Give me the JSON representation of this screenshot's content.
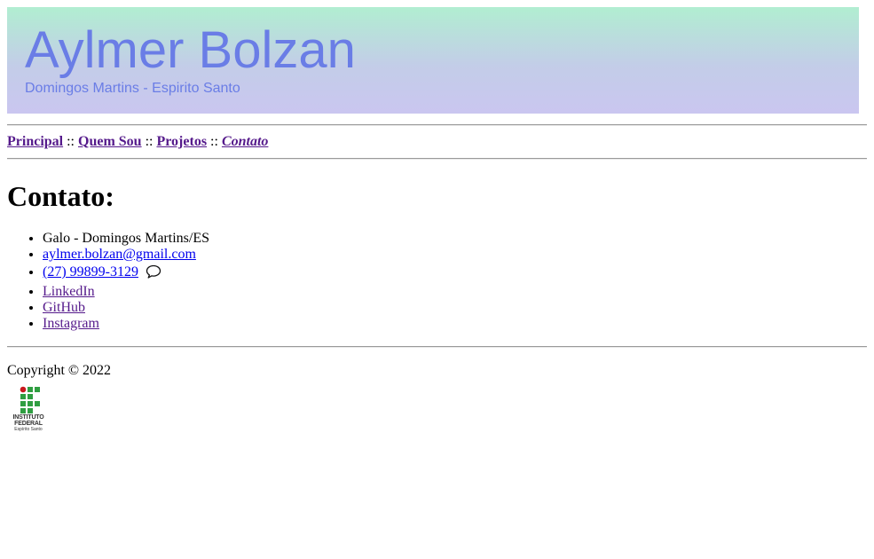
{
  "header": {
    "title": "Aylmer Bolzan",
    "subtitle": "Domingos Martins - Espirito Santo",
    "title_color": "#6a7de6",
    "gradient": [
      "#b1eed1",
      "#cac6f0"
    ]
  },
  "nav": {
    "items": [
      {
        "label": "Principal"
      },
      {
        "label": "Quem Sou"
      },
      {
        "label": "Projetos"
      },
      {
        "label": "Contato",
        "current": true
      }
    ],
    "separator": "::"
  },
  "main": {
    "heading": "Contato:",
    "contacts": [
      {
        "text": "Galo - Domingos Martins/ES",
        "link": false
      },
      {
        "text": "aylmer.bolzan@gmail.com",
        "link": true
      },
      {
        "text": "(27) 99899-3129",
        "link": true,
        "icon": "chat-bubble-icon"
      },
      {
        "text": "LinkedIn",
        "link": true
      },
      {
        "text": "GitHub",
        "link": true
      },
      {
        "text": "Instagram",
        "link": true
      }
    ]
  },
  "footer": {
    "copyright": "Copyright © 2022",
    "logo": {
      "line1": "INSTITUTO",
      "line2": "FEDERAL",
      "line3": "Espírito Santo",
      "colors": {
        "red": "#c8191e",
        "green": "#2f9e41"
      }
    }
  }
}
